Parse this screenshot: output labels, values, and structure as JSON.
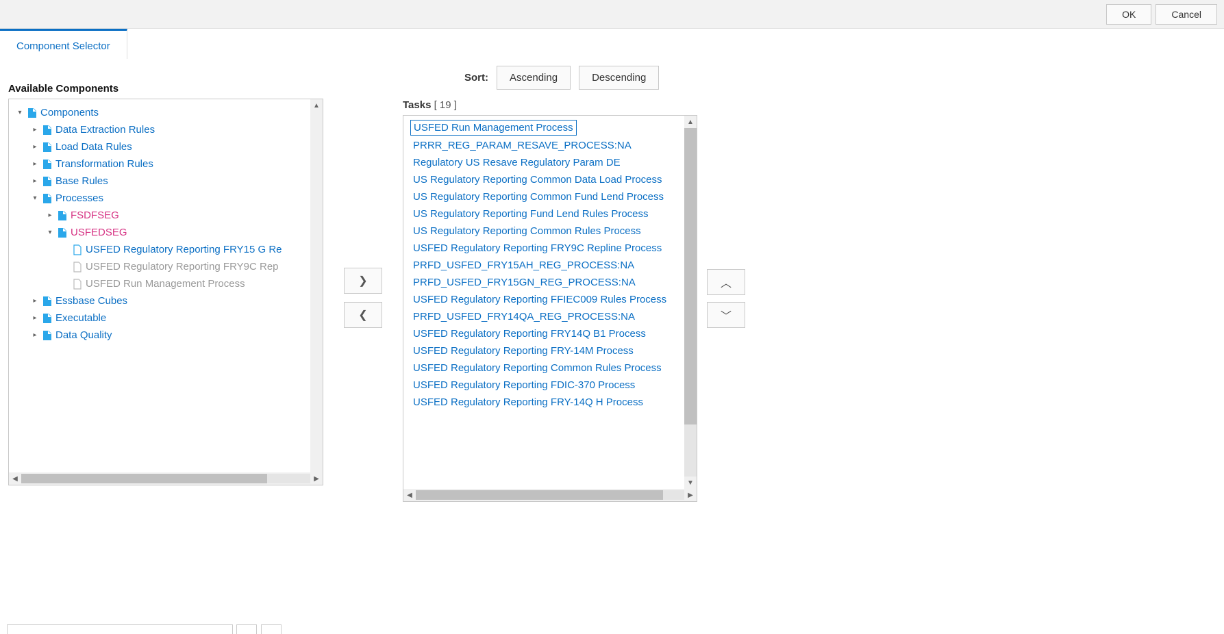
{
  "dialog": {
    "ok": "OK",
    "cancel": "Cancel"
  },
  "tab": {
    "label": "Component Selector"
  },
  "left": {
    "heading": "Available Components",
    "tree": {
      "root": "Components",
      "n1": "Data Extraction Rules",
      "n2": "Load Data Rules",
      "n3": "Transformation Rules",
      "n4": "Base Rules",
      "n5": "Processes",
      "n5a": "FSDFSEG",
      "n5b": "USFEDSEG",
      "n5b1": "USFED Regulatory Reporting FRY15 G Re",
      "n5b2": "USFED Regulatory Reporting FRY9C Rep",
      "n5b3": "USFED Run Management Process",
      "n6": "Essbase Cubes",
      "n7": "Executable",
      "n8": "Data Quality"
    }
  },
  "sort": {
    "label": "Sort:",
    "asc": "Ascending",
    "desc": "Descending"
  },
  "tasks": {
    "label": "Tasks",
    "count": "[ 19 ]",
    "items": [
      "USFED Run Management Process",
      "PRRR_REG_PARAM_RESAVE_PROCESS:NA",
      "Regulatory US Resave Regulatory Param DE",
      "US Regulatory Reporting Common Data Load Process",
      "US Regulatory Reporting Common Fund Lend Process",
      "US Regulatory Reporting Fund Lend Rules Process",
      "US Regulatory Reporting Common Rules Process",
      "USFED Regulatory Reporting FRY9C Repline Process",
      "PRFD_USFED_FRY15AH_REG_PROCESS:NA",
      "PRFD_USFED_FRY15GN_REG_PROCESS:NA",
      "USFED Regulatory Reporting FFIEC009 Rules Process",
      "PRFD_USFED_FRY14QA_REG_PROCESS:NA",
      "USFED Regulatory Reporting FRY14Q B1 Process",
      "USFED Regulatory Reporting FRY-14M Process",
      "USFED Regulatory Reporting Common Rules Process",
      "USFED Regulatory Reporting FDIC-370 Process",
      "USFED Regulatory Reporting FRY-14Q H Process"
    ]
  }
}
